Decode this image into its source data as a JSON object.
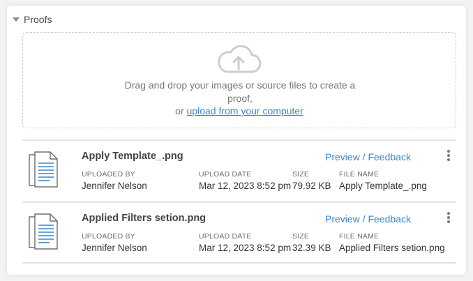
{
  "section": {
    "title": "Proofs"
  },
  "dropzone": {
    "text": "Drag and drop your images or source files to create a proof,",
    "prefix": "or",
    "link": "upload from your computer"
  },
  "columns": {
    "uploaded_by": "UPLOADED BY",
    "upload_date": "UPLOAD DATE",
    "size": "SIZE",
    "file_name": "FILE NAME"
  },
  "files": [
    {
      "title": "Apply Template_.png",
      "preview": "Preview / Feedback",
      "uploaded_by": "Jennifer Nelson",
      "upload_date": "Mar 12, 2023 8:52 pm",
      "size": "79.92 KB",
      "file_name": "Apply Template_.png"
    },
    {
      "title": "Applied Filters setion.png",
      "preview": "Preview / Feedback",
      "uploaded_by": "Jennifer Nelson",
      "upload_date": "Mar 12, 2023 8:52 pm",
      "size": "32.39 KB",
      "file_name": "Applied Filters setion.png"
    }
  ],
  "colors": {
    "link": "#3a86c8",
    "border": "#e2e2e2",
    "dashed": "#c9ced3"
  },
  "icons": {
    "upload": "cloud-upload-icon",
    "file": "document-icon",
    "menu": "kebab-menu-icon",
    "toggle": "caret-down-icon"
  }
}
